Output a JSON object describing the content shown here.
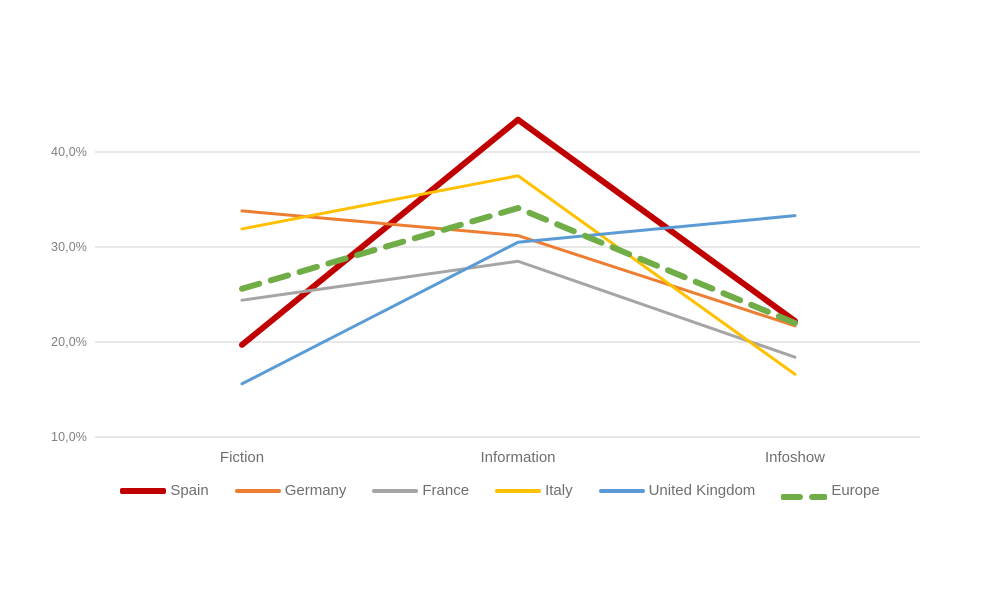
{
  "chart_data": {
    "type": "line",
    "title": "",
    "subtitle": "",
    "xlabel": "",
    "ylabel": "",
    "categories": [
      "Fiction",
      "Information",
      "Infoshow"
    ],
    "ylim": [
      10.0,
      45.0
    ],
    "yticks": [
      10.0,
      20.0,
      30.0,
      40.0
    ],
    "ytick_labels": [
      "10,0%",
      "20,0%",
      "30,0%",
      "40,0%"
    ],
    "grid": "horizontal",
    "legend_position": "bottom",
    "value_suffix": "%",
    "decimal_separator": ",",
    "series": [
      {
        "name": "Spain",
        "color": "#C00000",
        "style": "solid",
        "width": 6,
        "values": [
          19.7,
          43.4,
          22.2
        ]
      },
      {
        "name": "Germany",
        "color": "#ED7D31",
        "style": "solid",
        "width": 3,
        "values": [
          33.8,
          31.2,
          21.7
        ]
      },
      {
        "name": "France",
        "color": "#A5A5A5",
        "style": "solid",
        "width": 3,
        "values": [
          24.4,
          28.5,
          18.4
        ]
      },
      {
        "name": "Italy",
        "color": "#FFC000",
        "style": "solid",
        "width": 3,
        "values": [
          31.9,
          37.5,
          16.6
        ]
      },
      {
        "name": "United Kingdom",
        "color": "#5B9BD5",
        "style": "solid",
        "width": 3,
        "values": [
          15.6,
          30.5,
          33.3
        ]
      },
      {
        "name": "Europe",
        "color": "#70AD47",
        "style": "dashed",
        "width": 6,
        "values": [
          25.6,
          34.1,
          22.0
        ]
      }
    ]
  },
  "axis": {
    "y_ticks": [
      {
        "label": "40,0%",
        "value": 40.0
      },
      {
        "label": "30,0%",
        "value": 30.0
      },
      {
        "label": "20,0%",
        "value": 20.0
      },
      {
        "label": "10,0%",
        "value": 10.0
      }
    ],
    "x_ticks": [
      {
        "label": "Fiction"
      },
      {
        "label": "Information"
      },
      {
        "label": "Infoshow"
      }
    ]
  },
  "legend": {
    "items": [
      {
        "label": "Spain",
        "color": "#C00000",
        "style": "solid",
        "thick": true
      },
      {
        "label": "Germany",
        "color": "#ED7D31",
        "style": "solid",
        "thick": false
      },
      {
        "label": "France",
        "color": "#A5A5A5",
        "style": "solid",
        "thick": false
      },
      {
        "label": "Italy",
        "color": "#FFC000",
        "style": "solid",
        "thick": false
      },
      {
        "label": "United Kingdom",
        "color": "#5B9BD5",
        "style": "solid",
        "thick": false
      },
      {
        "label": "Europe",
        "color": "#70AD47",
        "style": "dashed",
        "thick": true
      }
    ]
  },
  "colors": {
    "background": "#ffffff",
    "gridline": "#d9d9d9",
    "tick_text": "#808080",
    "category_text": "#6f6f6f"
  }
}
